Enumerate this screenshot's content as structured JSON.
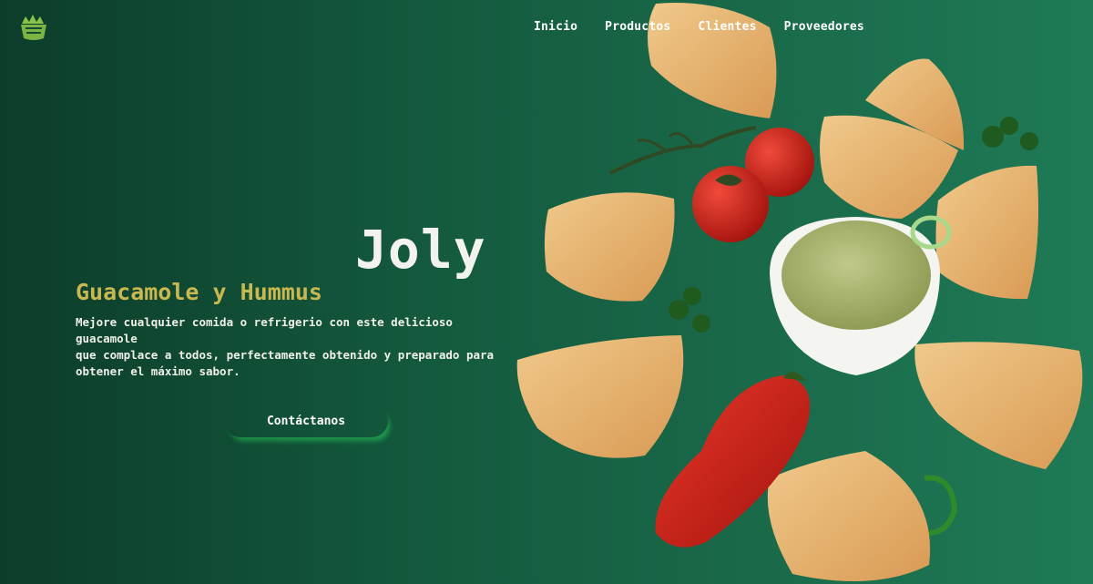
{
  "nav": {
    "items": [
      "Inicio",
      "Productos",
      "Clientes",
      "Proveedores"
    ]
  },
  "logo": {
    "icon": "leaf-basket-logo-icon",
    "color": "#8bc34a"
  },
  "hero": {
    "brand": "Joly",
    "subtitle": "Guacamole y Hummus",
    "description_lines": [
      "Mejore cualquier comida o refrigerio con este delicioso guacamole",
      "que complace a todos, perfectamente obtenido y preparado para",
      "obtener el máximo sabor."
    ],
    "cta_label": "Contáctanos"
  },
  "colors": {
    "background_dark": "#0c3d2a",
    "background_light": "#1f7a56",
    "subtitle": "#c9b74f",
    "cta_glow": "#28d25a"
  }
}
